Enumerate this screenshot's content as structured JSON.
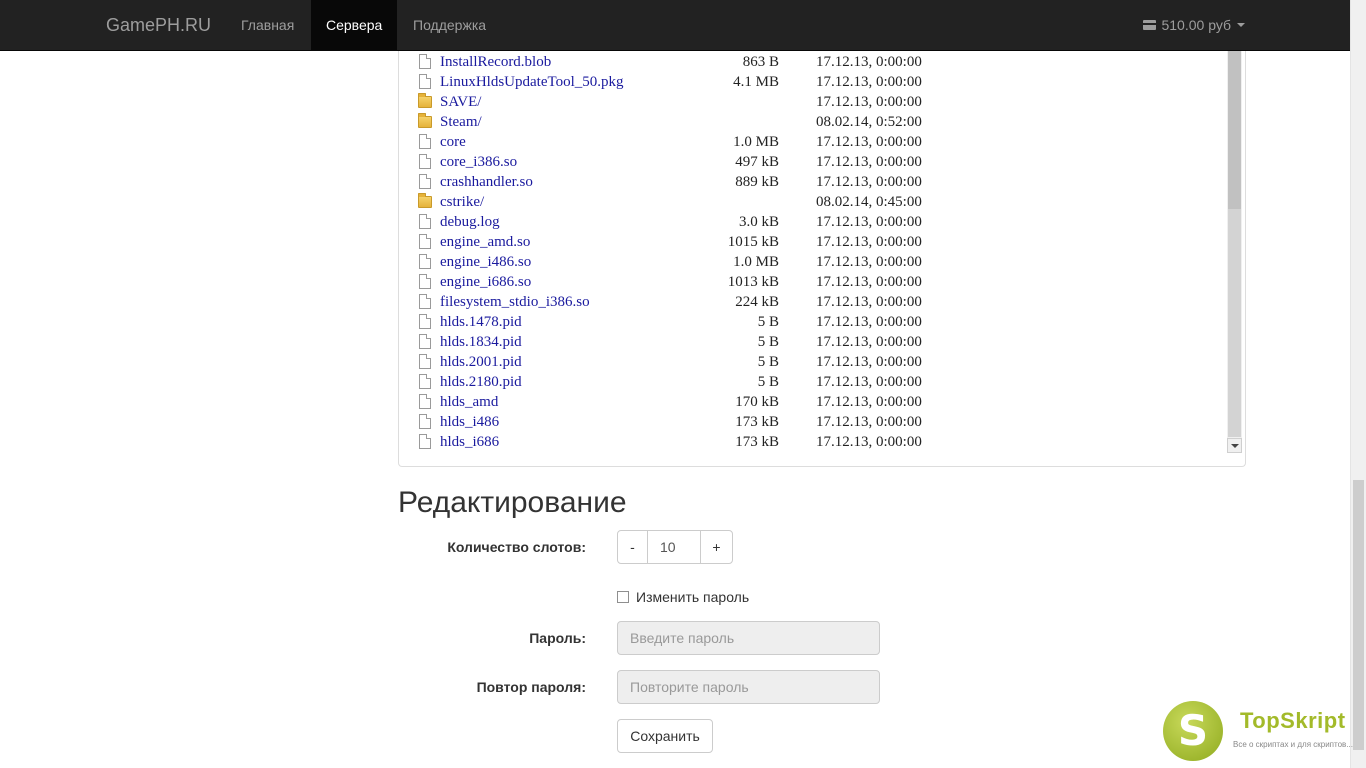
{
  "navbar": {
    "brand": "GamePH.RU",
    "items": [
      {
        "label": "Главная",
        "active": false
      },
      {
        "label": "Сервера",
        "active": true
      },
      {
        "label": "Поддержка",
        "active": false
      }
    ],
    "balance": "510.00 руб"
  },
  "files": [
    {
      "name": "InstallRecord.blob",
      "size": "863 B",
      "date": "17.12.13, 0:00:00",
      "type": "file"
    },
    {
      "name": "LinuxHldsUpdateTool_50.pkg",
      "size": "4.1 MB",
      "date": "17.12.13, 0:00:00",
      "type": "file"
    },
    {
      "name": "SAVE/",
      "size": "",
      "date": "17.12.13, 0:00:00",
      "type": "folder"
    },
    {
      "name": "Steam/",
      "size": "",
      "date": "08.02.14, 0:52:00",
      "type": "folder"
    },
    {
      "name": "core",
      "size": "1.0 MB",
      "date": "17.12.13, 0:00:00",
      "type": "file"
    },
    {
      "name": "core_i386.so",
      "size": "497 kB",
      "date": "17.12.13, 0:00:00",
      "type": "file"
    },
    {
      "name": "crashhandler.so",
      "size": "889 kB",
      "date": "17.12.13, 0:00:00",
      "type": "file"
    },
    {
      "name": "cstrike/",
      "size": "",
      "date": "08.02.14, 0:45:00",
      "type": "folder"
    },
    {
      "name": "debug.log",
      "size": "3.0 kB",
      "date": "17.12.13, 0:00:00",
      "type": "file"
    },
    {
      "name": "engine_amd.so",
      "size": "1015 kB",
      "date": "17.12.13, 0:00:00",
      "type": "file"
    },
    {
      "name": "engine_i486.so",
      "size": "1.0 MB",
      "date": "17.12.13, 0:00:00",
      "type": "file"
    },
    {
      "name": "engine_i686.so",
      "size": "1013 kB",
      "date": "17.12.13, 0:00:00",
      "type": "file"
    },
    {
      "name": "filesystem_stdio_i386.so",
      "size": "224 kB",
      "date": "17.12.13, 0:00:00",
      "type": "file"
    },
    {
      "name": "hlds.1478.pid",
      "size": "5 B",
      "date": "17.12.13, 0:00:00",
      "type": "file"
    },
    {
      "name": "hlds.1834.pid",
      "size": "5 B",
      "date": "17.12.13, 0:00:00",
      "type": "file"
    },
    {
      "name": "hlds.2001.pid",
      "size": "5 B",
      "date": "17.12.13, 0:00:00",
      "type": "file"
    },
    {
      "name": "hlds.2180.pid",
      "size": "5 B",
      "date": "17.12.13, 0:00:00",
      "type": "file"
    },
    {
      "name": "hlds_amd",
      "size": "170 kB",
      "date": "17.12.13, 0:00:00",
      "type": "file"
    },
    {
      "name": "hlds_i486",
      "size": "173 kB",
      "date": "17.12.13, 0:00:00",
      "type": "file"
    },
    {
      "name": "hlds_i686",
      "size": "173 kB",
      "date": "17.12.13, 0:00:00",
      "type": "file"
    }
  ],
  "edit": {
    "title": "Редактирование",
    "slots_label": "Количество слотов:",
    "slots_minus": "-",
    "slots_value": "10",
    "slots_plus": "+",
    "change_password_label": "Изменить пароль",
    "change_password_checked": false,
    "password_label": "Пароль:",
    "password_placeholder": "Введите пароль",
    "password_repeat_label": "Повтор пароля:",
    "password_repeat_placeholder": "Повторите пароль",
    "save_label": "Сохранить"
  },
  "watermark": {
    "letter": "S",
    "title": "TopSkript",
    "subtitle": "Все о скриптах и для скриптов..."
  }
}
